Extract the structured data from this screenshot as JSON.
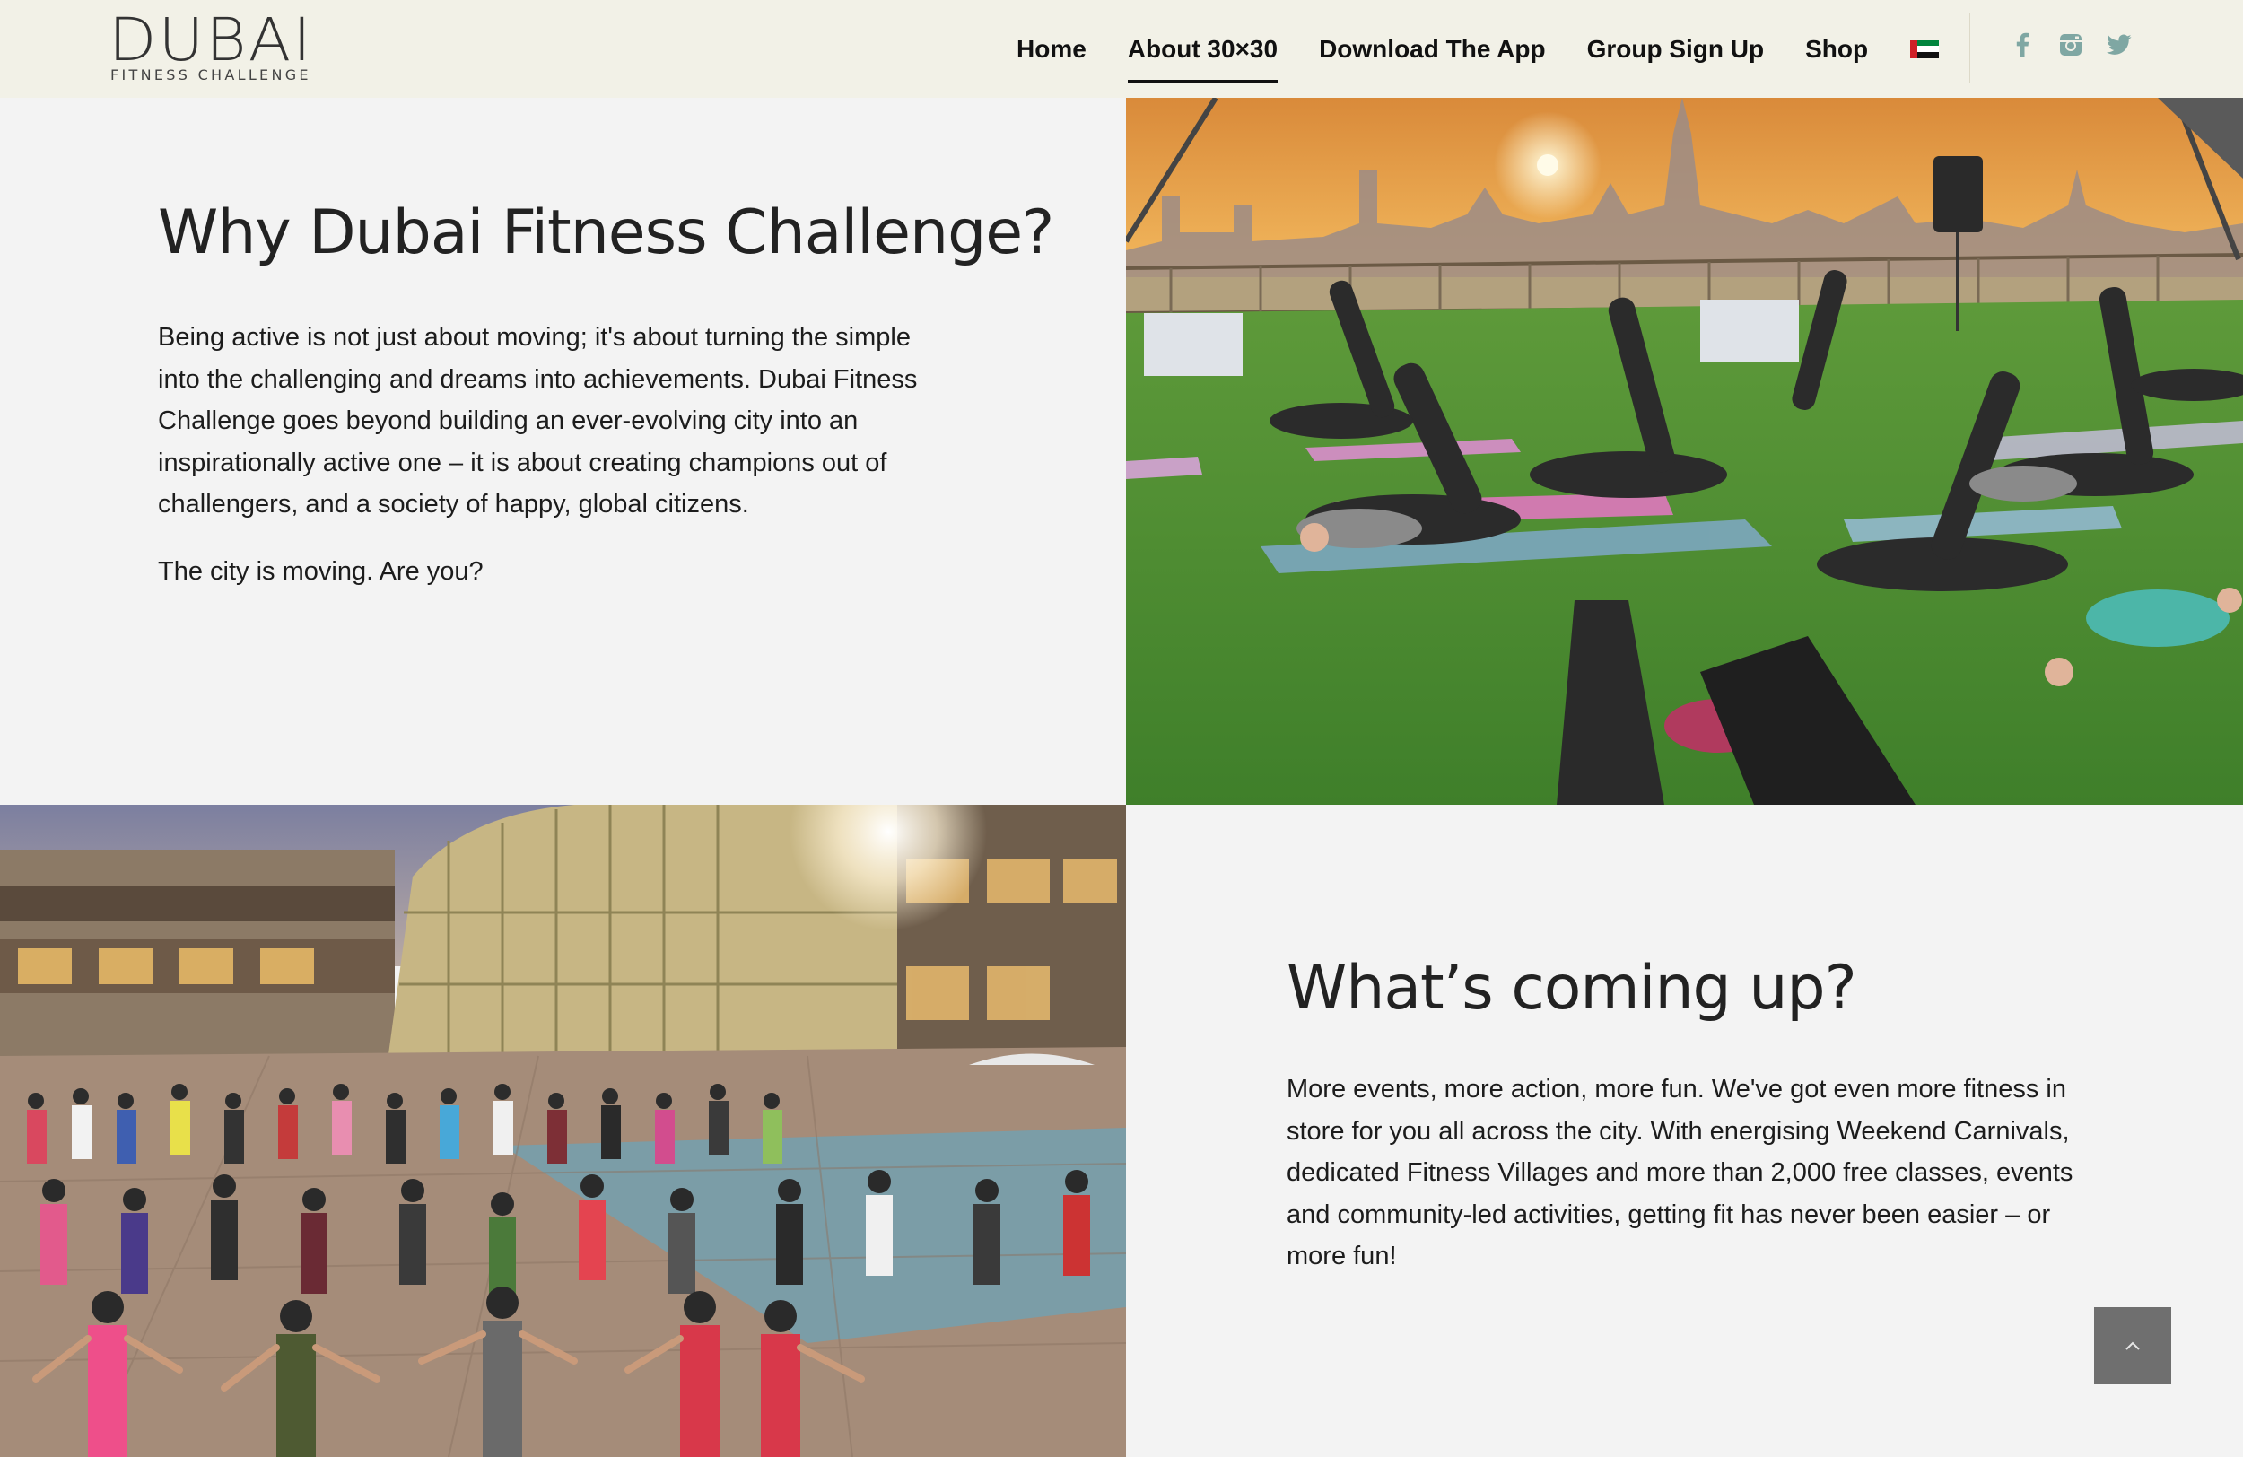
{
  "header": {
    "logo_main": "DUBAI",
    "logo_sub": "FITNESS CHALLENGE",
    "nav": [
      {
        "label": "Home",
        "active": false
      },
      {
        "label": "About 30×30",
        "active": true
      },
      {
        "label": "Download The App",
        "active": false
      },
      {
        "label": "Group Sign Up",
        "active": false
      },
      {
        "label": "Shop",
        "active": false
      }
    ],
    "language_flag": "uae-flag-icon",
    "social_icons": [
      "facebook-icon",
      "instagram-icon",
      "twitter-icon"
    ],
    "social_color": "#7fa7a3"
  },
  "section_why": {
    "heading": "Why Dubai Fitness Challenge?",
    "paragraph_lines": [
      "Being active is not just about moving; it's about turning the simple",
      "into the challenging and dreams into achievements. Dubai Fitness",
      "Challenge goes beyond building an ever-evolving city into an",
      "inspirationally active one – it is about creating champions out of",
      "challengers, and a society of happy, global citizens."
    ],
    "tagline": "The city is moving. Are you?"
  },
  "section_coming": {
    "heading": "What’s coming up?",
    "paragraph_lines": [
      "More events, more action, more fun. We've got even more fitness in",
      "store for you all across the city. With energising Weekend Carnivals,",
      "dedicated Fitness Villages and more than 2,000 free classes, events",
      "and community-led activities, getting fit has never been easier – or",
      "more fun!"
    ]
  },
  "images": {
    "yoga_photo": "outdoor-yoga-sunset-photo",
    "crowd_photo": "mall-group-workout-photo"
  },
  "scroll_top_icon": "chevron-up-icon"
}
